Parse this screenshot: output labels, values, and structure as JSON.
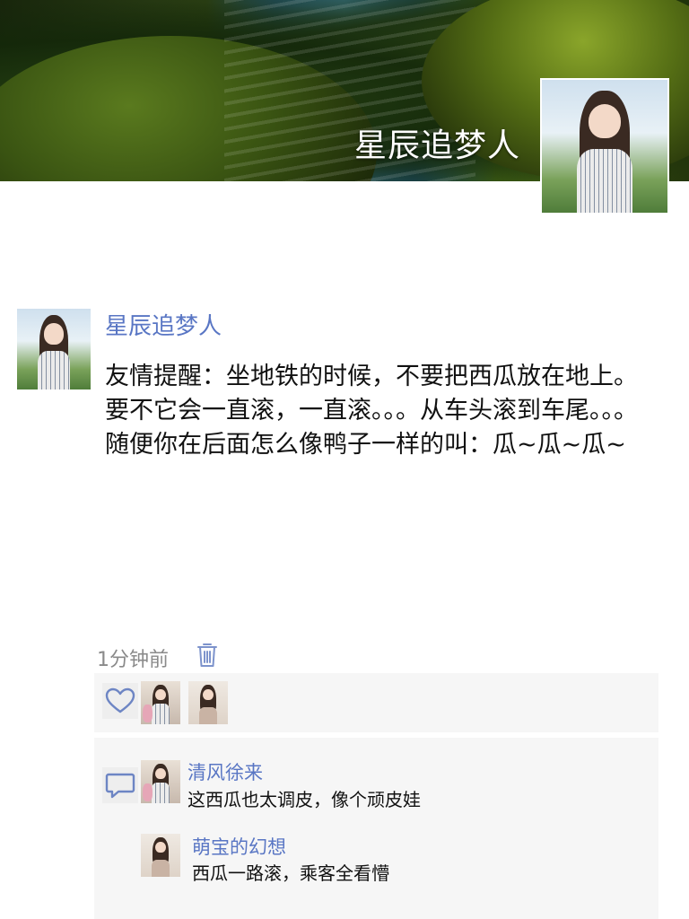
{
  "profile": {
    "cover_name": "星辰追梦人"
  },
  "post": {
    "author": "星辰追梦人",
    "text": "友情提醒：坐地铁的时候，不要把西瓜放在地上。 要不它会一直滚，一直滚。。。从车头滚到车尾。。。 随便你在后面怎么像鸭子一样的叫：瓜~瓜~瓜~",
    "time": "1分钟前"
  },
  "icons": {
    "delete": "trash-icon",
    "like": "heart-icon",
    "comment": "comment-icon"
  },
  "comments": [
    {
      "author": "清风徐来",
      "text": "这西瓜也太调皮，像个顽皮娃"
    },
    {
      "author": "萌宝的幻想",
      "text": "西瓜一路滚，乘客全看懵"
    }
  ],
  "colors": {
    "link": "#5976c4",
    "box_bg": "#f6f6f6"
  }
}
